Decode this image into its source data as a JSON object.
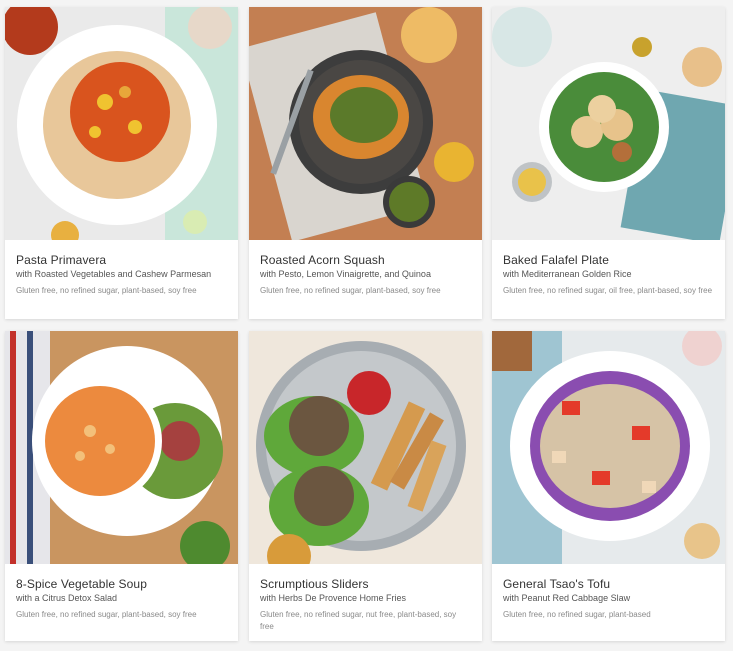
{
  "recipes": [
    {
      "title": "Pasta Primavera",
      "subtitle": "with Roasted Vegetables and Cashew Parmesan",
      "diet": "Gluten free, no refined sugar, plant-based, soy free"
    },
    {
      "title": "Roasted Acorn Squash",
      "subtitle": "with Pesto, Lemon Vinaigrette, and Quinoa",
      "diet": "Gluten free, no refined sugar, plant-based, soy free"
    },
    {
      "title": "Baked Falafel Plate",
      "subtitle": "with Mediterranean Golden Rice",
      "diet": "Gluten free, no refined sugar, oil free, plant-based, soy free"
    },
    {
      "title": "8-Spice Vegetable Soup",
      "subtitle": "with a Citrus Detox Salad",
      "diet": "Gluten free, no refined sugar, plant-based, soy free"
    },
    {
      "title": "Scrumptious Sliders",
      "subtitle": "with Herbs De Provence Home Fries",
      "diet": "Gluten free, no refined sugar, nut free, plant-based, soy free"
    },
    {
      "title": "General Tsao's Tofu",
      "subtitle": "with Peanut Red Cabbage Slaw",
      "diet": "Gluten free, no refined sugar, plant-based"
    }
  ]
}
